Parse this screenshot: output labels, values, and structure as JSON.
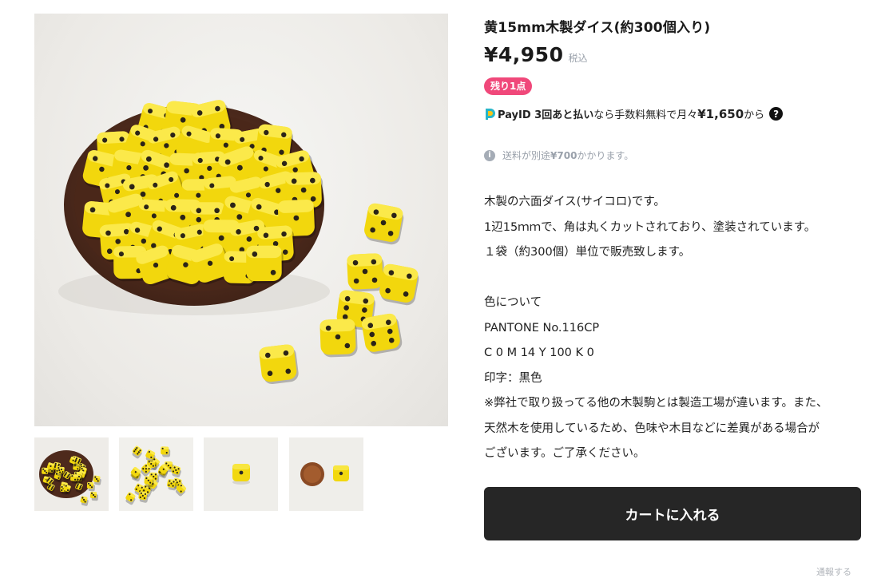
{
  "product": {
    "title": "黄15mm木製ダイス(約300個入り)",
    "price": "¥4,950",
    "tax_label": "税込",
    "stock_badge": "残り1点"
  },
  "payment": {
    "brand": "PayID 3回あと払い",
    "text_mid": "なら手数料無料で月々",
    "amount": "¥1,650",
    "text_end": "から",
    "help": "?"
  },
  "shipping": {
    "prefix": "送料が別途",
    "fee": "¥700",
    "suffix": "かかります。"
  },
  "description": [
    "木製の六面ダイス(サイコロ)です。",
    "1辺15ｍｍで、角は丸くカットされており、塗装されています。",
    "１袋（約300個）単位で販売致します。",
    "",
    "色について",
    "PANTONE No.116CP",
    "C 0 M 14 Y 100 K 0",
    "印字：黒色",
    "※弊社で取り扱ってる他の木製駒とは製造工場が違います。また、",
    "天然木を使用しているため、色味や木目などに差異がある場合が",
    "ございます。ご了承ください。"
  ],
  "cart_button": "カートに入れる",
  "report_link": "通報する",
  "colors": {
    "badge": "#f0487a",
    "button": "#262626",
    "dice_yellow": "#f5dd12",
    "bowl": "#5a3222"
  },
  "icons": [
    "payid-logo-icon",
    "help-icon",
    "info-icon"
  ]
}
